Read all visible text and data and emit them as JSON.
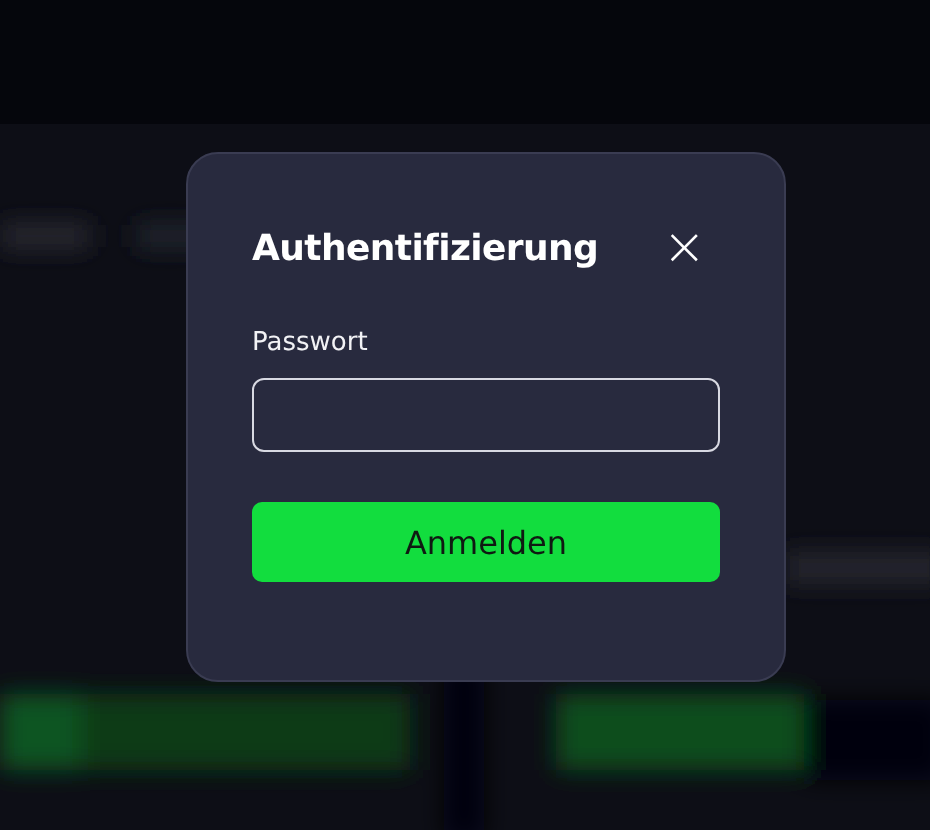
{
  "dialog": {
    "title": "Authentifizierung",
    "close": "×",
    "fields": [
      {
        "label": "Passwort"
      }
    ],
    "submit": "Anmelden"
  }
}
